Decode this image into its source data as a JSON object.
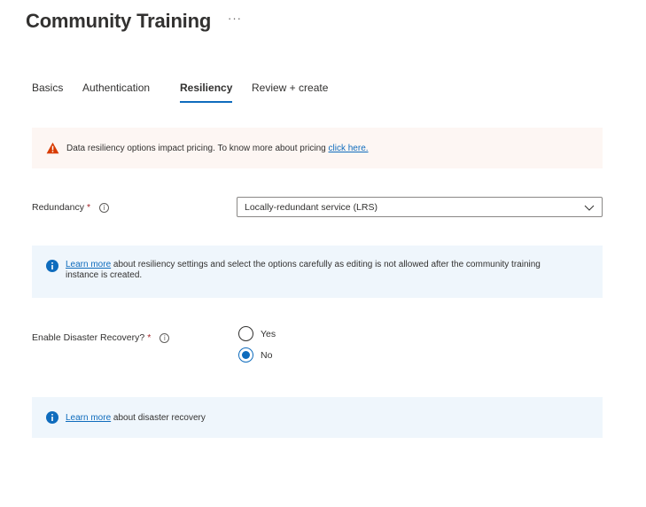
{
  "header": {
    "title": "Community Training",
    "more_glyph": "···"
  },
  "tabs": [
    {
      "label": "Basics"
    },
    {
      "label": "Authentication"
    },
    {
      "label": "Resiliency",
      "active": true
    },
    {
      "label": "Review + create"
    }
  ],
  "warning_banner": {
    "text": "Data resiliency options impact pricing. To know more about pricing ",
    "link": "click here."
  },
  "redundancy": {
    "label": "Redundancy",
    "required_mark": "*",
    "info_glyph": "i",
    "selected": "Locally-redundant service (LRS)"
  },
  "resiliency_info": {
    "link": "Learn more",
    "text": " about resiliency settings and select the options carefully as editing is not allowed after the community training instance is created."
  },
  "disaster_recovery": {
    "label": "Enable Disaster Recovery?",
    "required_mark": "*",
    "info_glyph": "i",
    "options": [
      {
        "label": "Yes",
        "checked": false
      },
      {
        "label": "No",
        "checked": true
      }
    ]
  },
  "dr_info": {
    "link": "Learn more",
    "text": " about disaster recovery"
  },
  "colors": {
    "accent": "#0f6cbd",
    "warning_bg": "#fdf6f3",
    "warning_icon": "#d83b01",
    "info_bg": "#eff6fc",
    "required": "#a4262c"
  }
}
